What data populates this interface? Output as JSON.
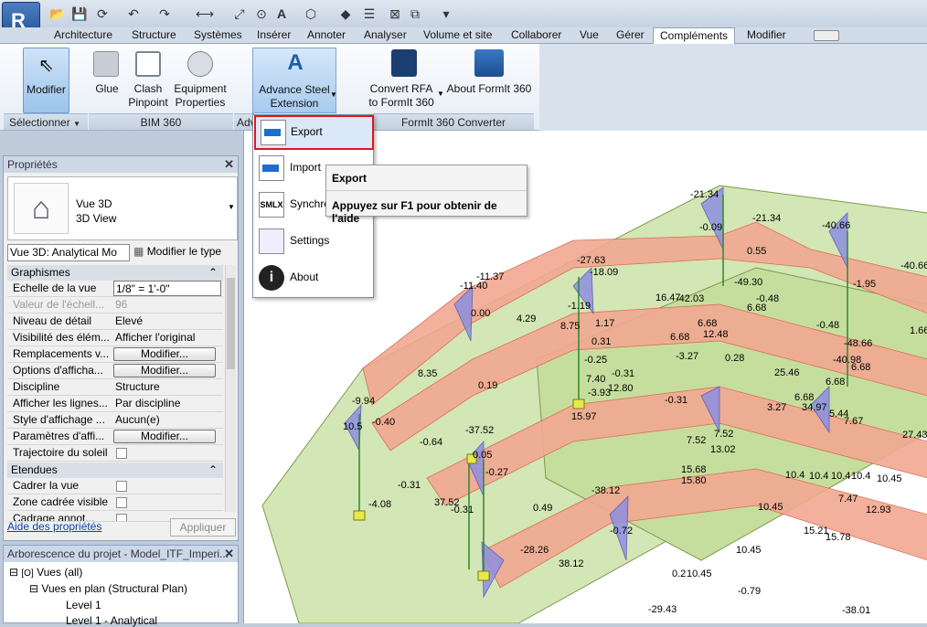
{
  "app": {
    "button_letter": "R"
  },
  "ribbon_tabs": [
    "Architecture",
    "Structure",
    "Systèmes",
    "Insérer",
    "Annoter",
    "Analyser",
    "Volume et site",
    "Collaborer",
    "Vue",
    "Gérer",
    "Compléments",
    "Modifier"
  ],
  "ribbon": {
    "modifier_label": "Modifier",
    "glue_label": "Glue",
    "clash_label": "Clash\nPinpoint",
    "equipment_label": "Equipment\nProperties",
    "advance_steel_label": "Advance Steel\nExtension",
    "convert_rfa_label": "Convert RFA\nto FormIt 360",
    "about_formit_label": "About FormIt 360",
    "panel_select": "Sélectionner",
    "panel_bim360": "BIM 360",
    "panel_adv": "Adv",
    "panel_formit": "FormIt 360 Converter"
  },
  "menu": {
    "items": [
      "Export",
      "Import",
      "Synchro",
      "Settings",
      "About"
    ]
  },
  "tooltip": {
    "title": "Export",
    "help": "Appuyez sur F1 pour obtenir de l'aide"
  },
  "properties": {
    "title": "Propriétés",
    "type_name": "Vue 3D",
    "type_sub": "3D View",
    "selector": "Vue 3D: Analytical Mo",
    "edit_type": "Modifier le type",
    "section_graphics": "Graphismes",
    "section_extents": "Etendues",
    "rows": [
      {
        "k": "Echelle de la vue",
        "v": "1/8\" = 1'-0\""
      },
      {
        "k": "Valeur de l'échell...",
        "v": "96"
      },
      {
        "k": "Niveau de détail",
        "v": "Elevé"
      },
      {
        "k": "Visibilité des élém...",
        "v": "Afficher l'original"
      },
      {
        "k": "Remplacements v...",
        "v": "Modifier..."
      },
      {
        "k": "Options d'afficha...",
        "v": "Modifier..."
      },
      {
        "k": "Discipline",
        "v": "Structure"
      },
      {
        "k": "Afficher les lignes...",
        "v": "Par discipline"
      },
      {
        "k": "Style d'affichage ...",
        "v": "Aucun(e)"
      },
      {
        "k": "Paramètres d'affi...",
        "v": "Modifier..."
      },
      {
        "k": "Trajectoire du soleil",
        "v": ""
      }
    ],
    "extent_rows": [
      {
        "k": "Cadrer la vue",
        "v": ""
      },
      {
        "k": "Zone cadrée visible",
        "v": ""
      },
      {
        "k": "Cadrage annot...",
        "v": ""
      }
    ],
    "help_link": "Aide des propriétés",
    "apply": "Appliquer"
  },
  "project_browser": {
    "title": "Arborescence du projet - Model_ITF_Imperi...",
    "items": [
      "Vues (all)",
      "Vues en plan (Structural Plan)",
      "Level 1",
      "Level 1 - Analytical"
    ]
  },
  "view_labels": [
    "-21.34",
    "-0.09",
    "-21.34",
    "-40.66",
    "-40.66",
    "-27.63",
    "-18.09",
    "0.55",
    "-11.37",
    "-11.40",
    "-1.19",
    "-49.30",
    "-1.95",
    "0.00",
    "4.29",
    "8.75",
    "1.17",
    "16.47",
    "-42.03",
    "-0.48",
    "6.68",
    "6.68",
    "12.48",
    "-0.48",
    "1.66",
    "-48.66",
    "0.31",
    "6.68",
    "-0.25",
    "7.40",
    "-0.31",
    "-3.27",
    "0.28",
    "-40.98",
    "6.68",
    "-3.93",
    "12.80",
    "25.46",
    "8.35",
    "0.19",
    "6.68",
    "-0.31",
    "3.27",
    "34.97",
    "5.44",
    "7.67",
    "6.68",
    "-9.94",
    "15.97",
    "10.5",
    "-0.40",
    "-37.52",
    "7.52",
    "-0.64",
    "7.52",
    "13.02",
    "27.43",
    "0.05",
    "-0.27",
    "15.68",
    "15.80",
    "10.4",
    "10.4",
    "10.4",
    "10.4",
    "10.45",
    "-4.08",
    "-0.31",
    "37.52",
    "-0.31",
    "-38.12",
    "0.49",
    "7.47",
    "12.93",
    "10.45",
    "-0.72",
    "15.21",
    "15.78",
    "-28.26",
    "10.45",
    "38.12",
    "0.2",
    "10.45",
    "-0.79",
    "-29.43",
    "-38.01"
  ]
}
